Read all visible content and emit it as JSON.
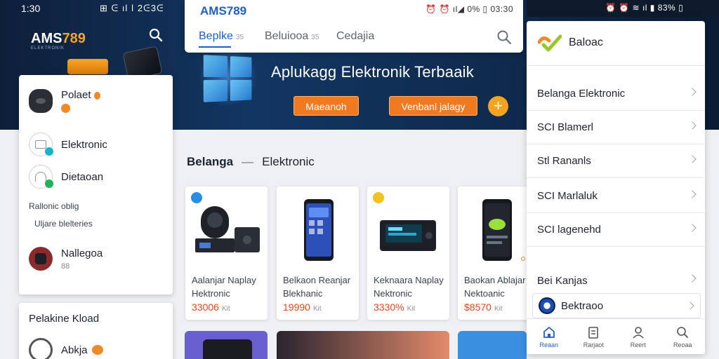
{
  "status_left": {
    "time": "1:30",
    "icons": "⊞ ᕮ ıl ǀ 2ᕮ3ᕮ"
  },
  "left_app": {
    "brand": "AMS",
    "brand_accent": "789",
    "brand_sub": "ELEKTRONIK"
  },
  "hero": {
    "title": "Aplukagg Elektronik Terbaaik",
    "button1": "Maeanoh",
    "button2": "Venbanl jalagy",
    "plus": "+"
  },
  "top_panel": {
    "brand": "AMS789",
    "status": "⏰ ⏰ ıl◢ 0% ▯ 03:30",
    "tabs": [
      {
        "label": "Beplke",
        "count": "35"
      },
      {
        "label": "Beluiooa",
        "count": "35"
      },
      {
        "label": "Cedajia"
      }
    ]
  },
  "left_card": {
    "items": [
      {
        "label": "Polaet"
      },
      {
        "label": "Elektronic"
      },
      {
        "label": "Dietaoan"
      }
    ],
    "small1": "Rallonic oblig",
    "small2": "Uljare blelteries",
    "item4": {
      "label": "Nallegoa",
      "sub": "88"
    }
  },
  "left_card2": {
    "title": "Pelakine Kload",
    "item_label": "Abkja"
  },
  "section": {
    "title_strong": "Belanga",
    "separator": "—",
    "title": "Elektronic"
  },
  "products": [
    {
      "name": "Aalanjar Naplay Hektronic",
      "price": "33006",
      "unit": "Kit"
    },
    {
      "name": "Belkaon Reanjar Blekhanic",
      "price": "19990",
      "unit": "Kit"
    },
    {
      "name": "Keknaara Naplay Nektronic",
      "price": "3330%",
      "unit": "Kit"
    },
    {
      "name": "Baokan Ablajar Nektoanic",
      "price": "$8570",
      "unit": "Kit"
    }
  ],
  "right_status": {
    "text": "⏰ ⏰ ≋ ıl ▮ 83% ▯"
  },
  "right_panel": {
    "title": "Baloac",
    "items": [
      "Belanga Elektronic",
      "SCI Blamerl",
      "Stl Rananls",
      "SCI Marlaluk",
      "SCI lagenehd",
      "Bei Kanjas"
    ],
    "highlight": "Bektraoo",
    "nav": [
      {
        "label": "Reaan",
        "icon": "home-icon"
      },
      {
        "label": "Rarjaot",
        "icon": "orders-icon"
      },
      {
        "label": "Reert",
        "icon": "profile-icon"
      },
      {
        "label": "Reoaa",
        "icon": "search-icon"
      }
    ]
  },
  "colors": {
    "accent_blue": "#1f5fbf",
    "accent_orange": "#f07a22",
    "price_red": "#e0491f"
  }
}
